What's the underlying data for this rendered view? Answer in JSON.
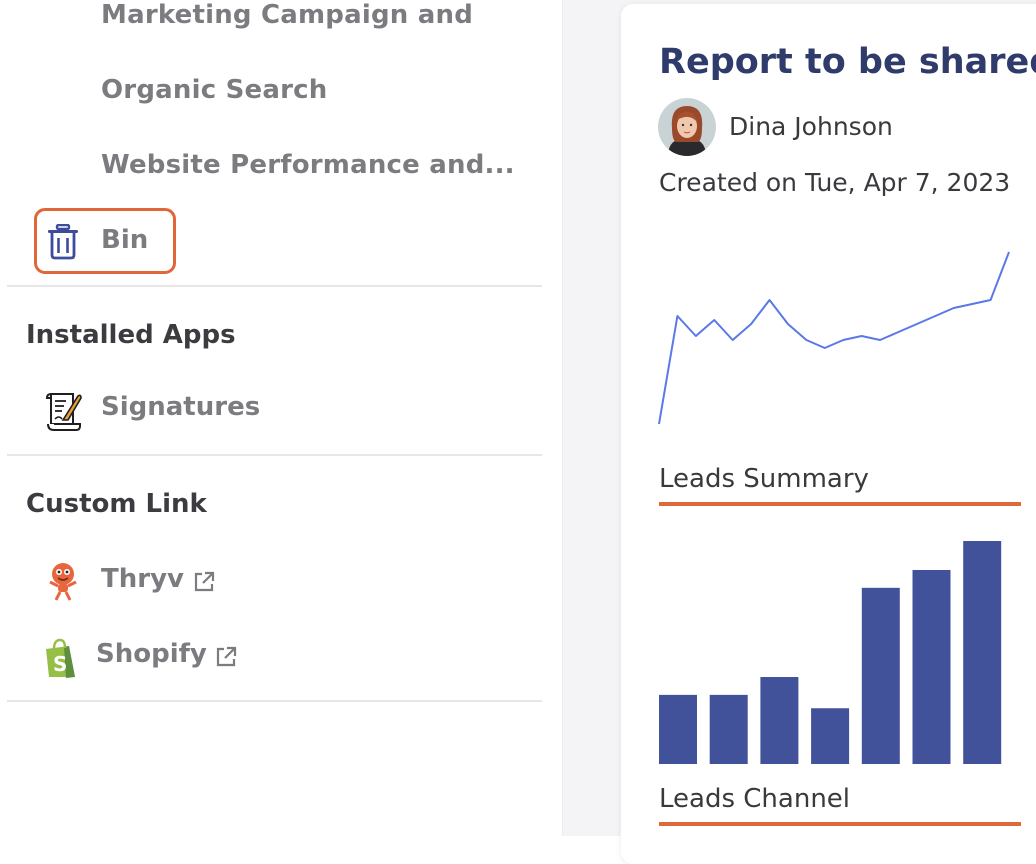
{
  "sidebar": {
    "items": [
      {
        "label": "Marketing Campaign and"
      },
      {
        "label": "Organic Search"
      },
      {
        "label": "Website Performance and..."
      }
    ],
    "bin": {
      "label": "Bin",
      "icon": "trash-icon",
      "highlight_color": "#e0673a"
    },
    "installed_apps": {
      "title": "Installed Apps",
      "items": [
        {
          "label": "Signatures",
          "icon": "signature-scroll-icon"
        }
      ]
    },
    "custom_link": {
      "title": "Custom Link",
      "items": [
        {
          "label": "Thryv",
          "icon": "thryv-mascot-icon",
          "external_icon": "external-link-icon"
        },
        {
          "label": "Shopify",
          "icon": "shopify-bag-icon",
          "external_icon": "external-link-icon"
        }
      ]
    }
  },
  "report": {
    "title": "Report to be shared",
    "author": "Dina Johnson",
    "created": "Created on Tue, Apr 7, 2023",
    "accent_color": "#e0673a"
  },
  "chart_data": [
    {
      "type": "line",
      "title": "Leads Summary",
      "color": "#5b78e8",
      "x": [
        1,
        2,
        3,
        4,
        5,
        6,
        7,
        8,
        9,
        10,
        11,
        12,
        13,
        14,
        15,
        16,
        17,
        18,
        19,
        20
      ],
      "values": [
        5,
        32,
        27,
        31,
        26,
        30,
        36,
        30,
        26,
        24,
        26,
        27,
        26,
        28,
        30,
        32,
        34,
        35,
        36,
        48
      ],
      "ylim": [
        0,
        50
      ]
    },
    {
      "type": "bar",
      "title": "Leads Channel",
      "color": "#42529a",
      "categories": [
        "",
        "",
        "",
        "",
        "",
        "",
        ""
      ],
      "values": [
        31,
        31,
        39,
        25,
        79,
        87,
        100
      ],
      "ylim": [
        0,
        100
      ]
    }
  ]
}
